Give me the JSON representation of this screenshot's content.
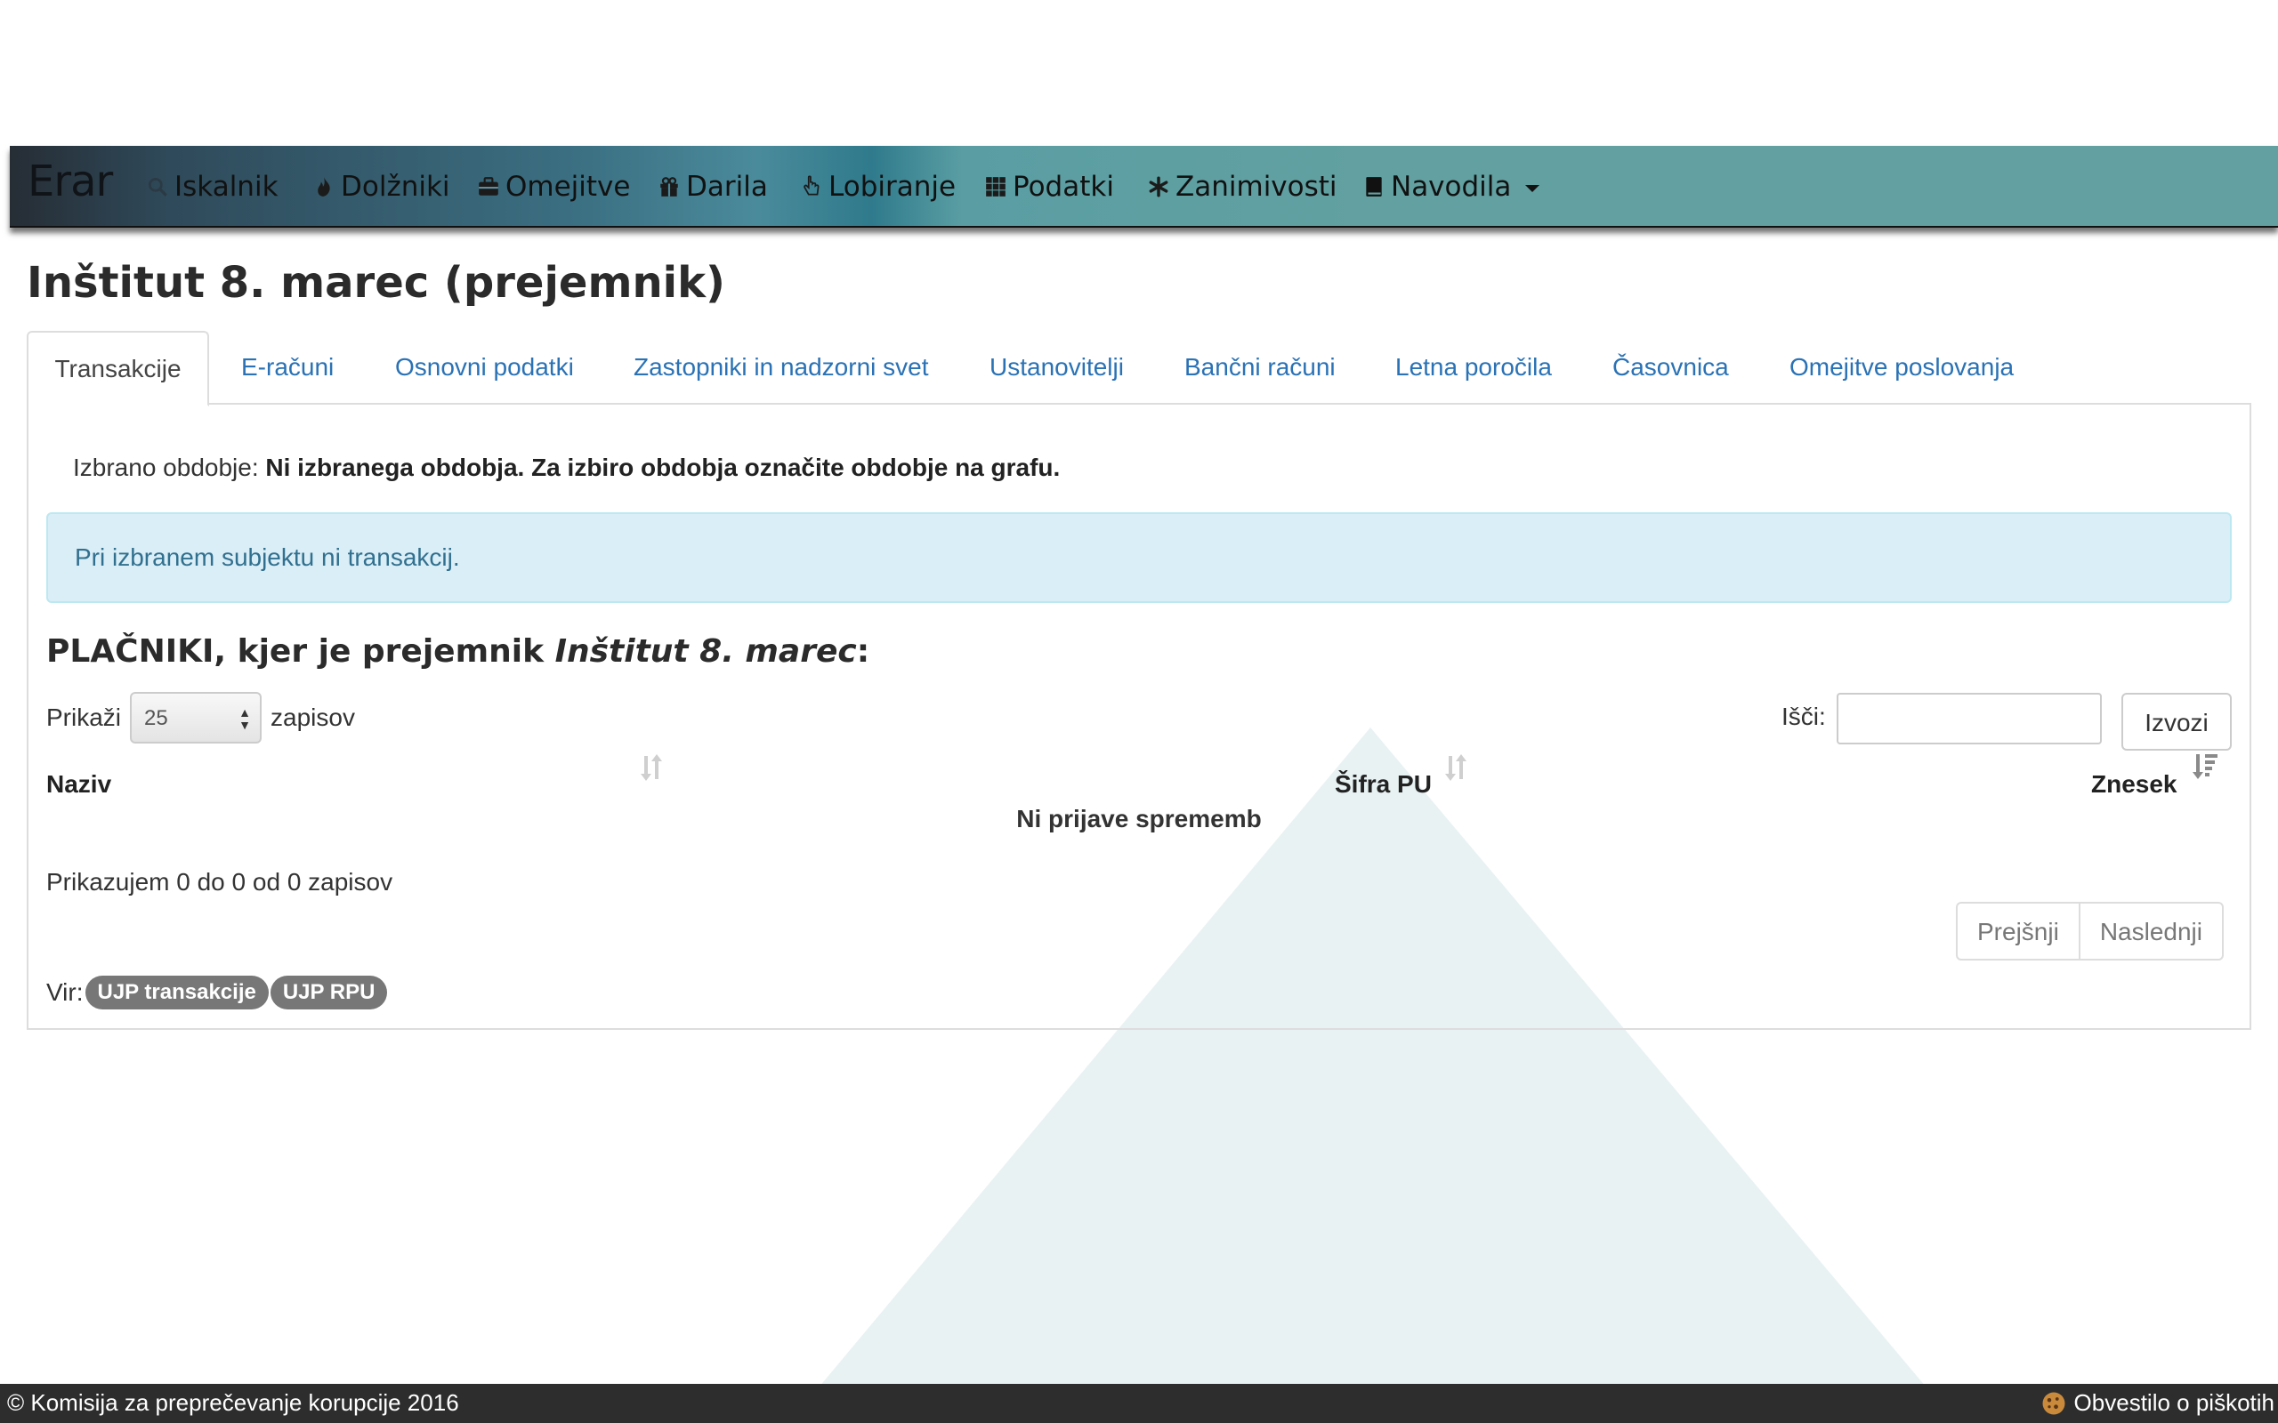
{
  "navbar": {
    "brand": "Erar",
    "items": [
      {
        "label": "Iskalnik",
        "icon": "search-icon"
      },
      {
        "label": "Dolžniki",
        "icon": "fire-icon"
      },
      {
        "label": "Omejitve",
        "icon": "briefcase-icon"
      },
      {
        "label": "Darila",
        "icon": "gift-icon"
      },
      {
        "label": "Lobiranje",
        "icon": "hand-pointer-icon"
      },
      {
        "label": "Podatki",
        "icon": "grid-icon"
      },
      {
        "label": "Zanimivosti",
        "icon": "asterisk-icon"
      },
      {
        "label": "Navodila",
        "icon": "book-icon"
      }
    ]
  },
  "page": {
    "title": "Inštitut 8. marec (prejemnik)"
  },
  "tabs": [
    "Transakcije",
    "E-računi",
    "Osnovni podatki",
    "Zastopniki in nadzorni svet",
    "Ustanovitelji",
    "Bančni računi",
    "Letna poročila",
    "Časovnica",
    "Omejitve poslovanja"
  ],
  "period": {
    "label": "Izbrano obdobje:",
    "value": "Ni izbranega obdobja. Za izbiro obdobja označite obdobje na grafu."
  },
  "alert": {
    "text": "Pri izbranem subjektu ni transakcij."
  },
  "section": {
    "prefix": "PLAČNIKI, kjer je prejemnik ",
    "entity": "Inštitut 8. marec",
    "suffix": ":"
  },
  "table_controls": {
    "show_label": "Prikaži",
    "page_size": "25",
    "records_label": "zapisov",
    "search_label": "Išči:",
    "search_value": "",
    "export_label": "Izvozi"
  },
  "table": {
    "columns": [
      "Naziv",
      "Šifra PU",
      "Znesek"
    ],
    "empty_message": "Ni prijave sprememb",
    "info": "Prikazujem 0 do 0 od 0 zapisov"
  },
  "pagination": {
    "previous": "Prejšnji",
    "next": "Naslednji"
  },
  "source": {
    "label": "Vir:",
    "badges": [
      "UJP transakcije",
      "UJP RPU"
    ]
  },
  "footer": {
    "copyright": "© Komisija za preprečevanje korupcije 2016",
    "cookie_notice": "Obvestilo o piškotih"
  },
  "colors": {
    "navbar_teal": "#62a0a1",
    "navbar_dark": "#262d35",
    "link": "#2a72b5",
    "alert_bg": "#d9edf7",
    "alert_text": "#31708f",
    "badge": "#777777",
    "footer": "#2d2d2d"
  }
}
